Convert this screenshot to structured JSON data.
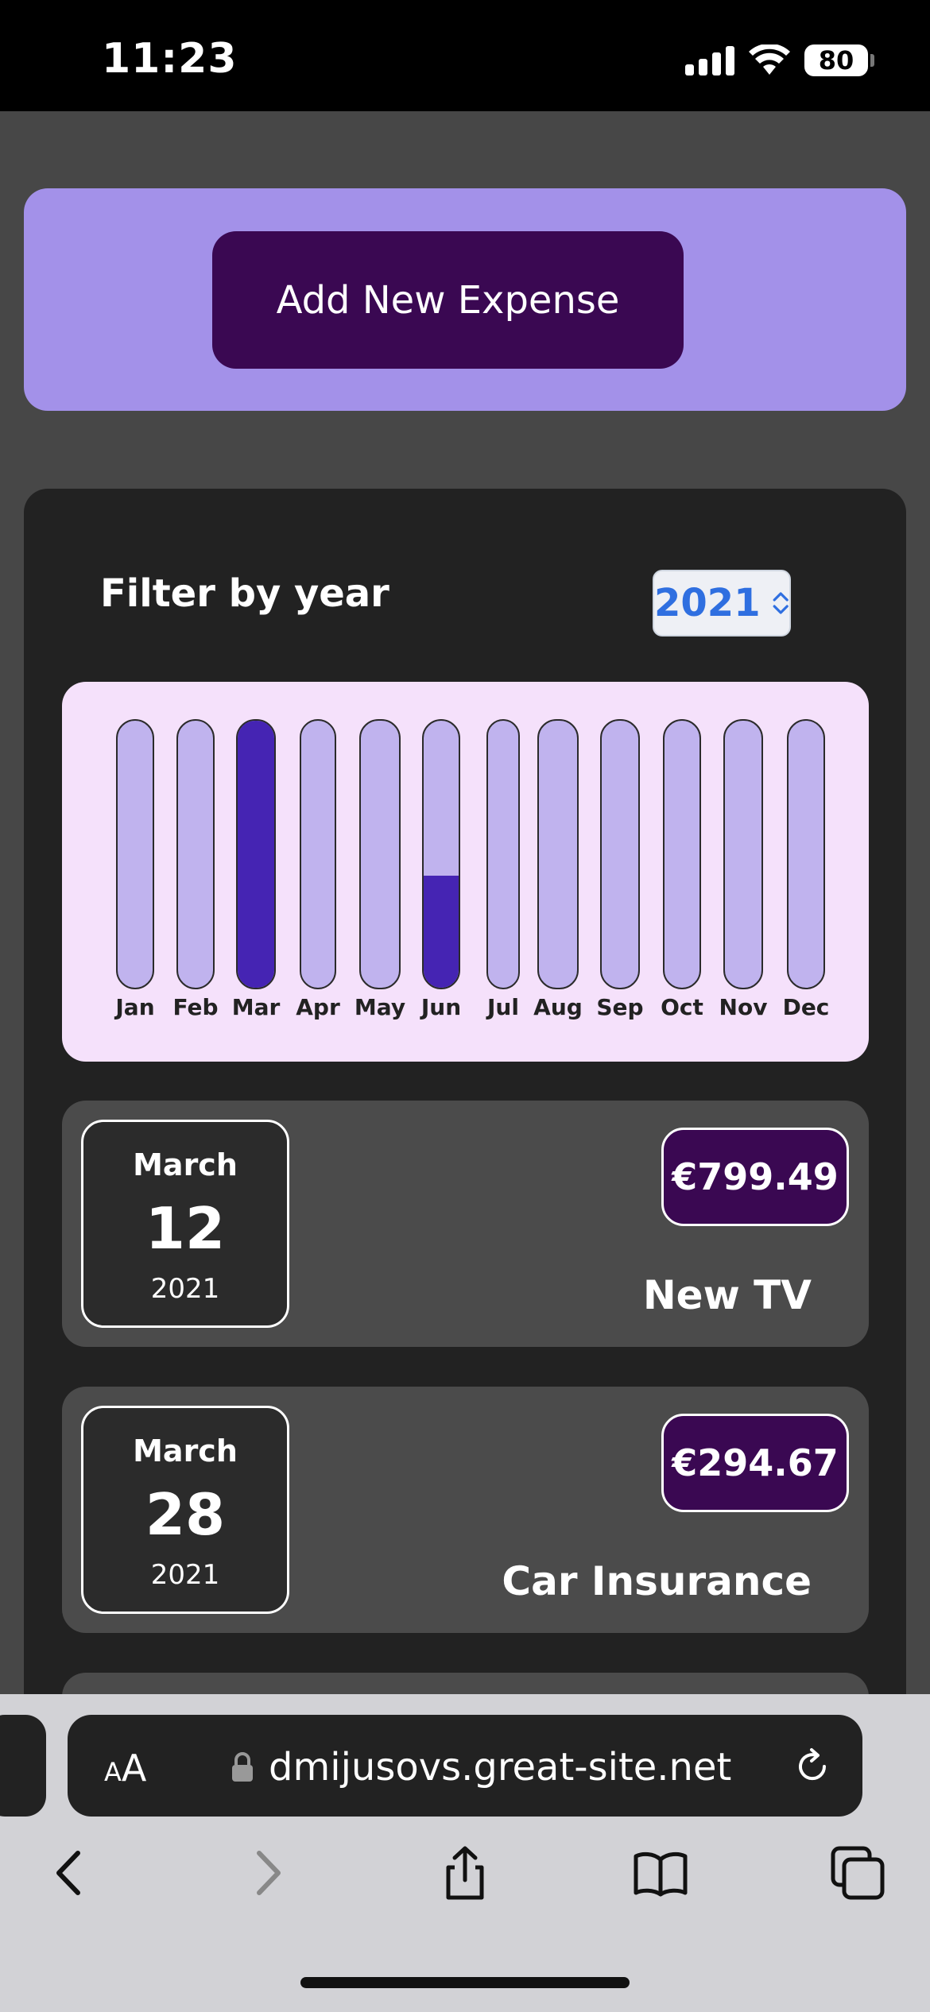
{
  "status_bar": {
    "time": "11:23",
    "battery": "80"
  },
  "add_button": {
    "label": "Add New Expense"
  },
  "filter": {
    "label": "Filter by year",
    "selected_year": "2021"
  },
  "chart_data": {
    "type": "bar",
    "categories": [
      "Jan",
      "Feb",
      "Mar",
      "Apr",
      "May",
      "Jun",
      "Jul",
      "Aug",
      "Sep",
      "Oct",
      "Nov",
      "Dec"
    ],
    "values": [
      0,
      0,
      1.0,
      0,
      0,
      0.42,
      0,
      0,
      0,
      0,
      0,
      0
    ],
    "ylim": [
      0,
      1
    ],
    "colors": {
      "track": "#c0b3ee",
      "fill": "#4524b3",
      "background": "#f5e1fb"
    }
  },
  "expenses": [
    {
      "month": "March",
      "day": "12",
      "year": "2021",
      "amount": "€799.49",
      "title": "New TV"
    },
    {
      "month": "March",
      "day": "28",
      "year": "2021",
      "amount": "€294.67",
      "title": "Car Insurance"
    }
  ],
  "browser": {
    "aa_label": "A",
    "aa_label_large": "A",
    "url": "dmijusovs.great-site.net"
  },
  "colors": {
    "accent": "#a391e9",
    "button": "#3a0852",
    "panel": "#222222",
    "item": "#4b4b4b"
  }
}
